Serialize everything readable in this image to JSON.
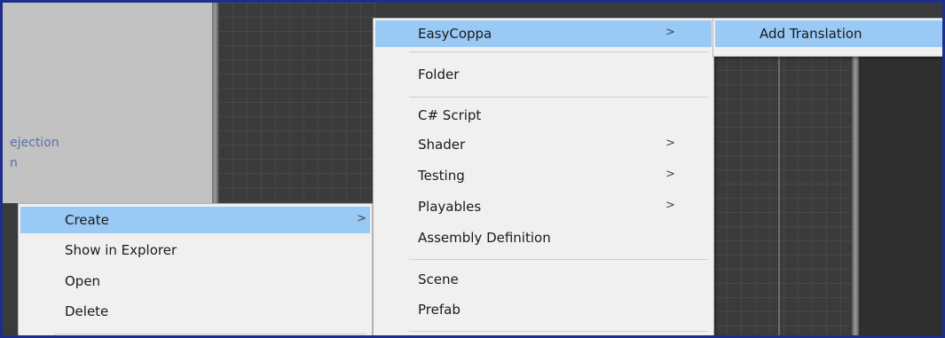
{
  "background": {
    "fragment_line1": "ejection",
    "fragment_line2": "n"
  },
  "context_menu": {
    "items": [
      {
        "label": "Create",
        "has_submenu": true,
        "highlighted": true
      },
      {
        "label": "Show in Explorer"
      },
      {
        "label": "Open"
      },
      {
        "label": "Delete"
      }
    ]
  },
  "create_submenu": {
    "items": [
      {
        "label": "EasyCoppa",
        "has_submenu": true,
        "highlighted": true
      },
      {
        "label": "Folder"
      },
      {
        "label": "C# Script"
      },
      {
        "label": "Shader",
        "has_submenu": true
      },
      {
        "label": "Testing",
        "has_submenu": true
      },
      {
        "label": "Playables",
        "has_submenu": true
      },
      {
        "label": "Assembly Definition"
      },
      {
        "label": "Scene"
      },
      {
        "label": "Prefab"
      }
    ]
  },
  "easycoppa_submenu": {
    "items": [
      {
        "label": "Add Translation",
        "highlighted": true
      }
    ]
  },
  "glyphs": {
    "submenu_arrow": ">"
  },
  "colors": {
    "highlight": "#99c9f5",
    "menu_bg": "#f0f0f0",
    "frame_border": "#1f2e8c",
    "background_text": "#5b6fa8"
  }
}
